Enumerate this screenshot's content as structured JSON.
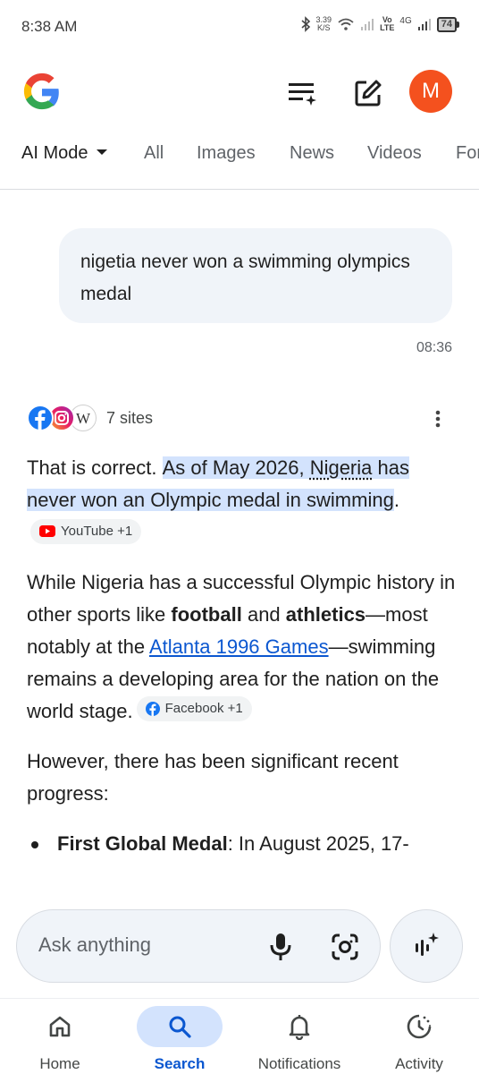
{
  "status_bar": {
    "time": "8:38 AM",
    "net_speed_value": "3.39",
    "net_speed_unit": "K/S",
    "network_label_top": "Vo",
    "network_label_bottom": "LTE",
    "network_type": "4G",
    "battery": "74"
  },
  "header": {
    "avatar_initial": "M",
    "avatar_color": "#f4511e"
  },
  "tabs": [
    {
      "label": "AI Mode",
      "active": true
    },
    {
      "label": "All"
    },
    {
      "label": "Images"
    },
    {
      "label": "News"
    },
    {
      "label": "Videos"
    },
    {
      "label": "For"
    }
  ],
  "query": {
    "text": "nigetia never won a swimming olympics medal",
    "time": "08:36"
  },
  "sources": {
    "label": "7 sites",
    "icons": [
      "facebook-icon",
      "instagram-icon",
      "wikipedia-icon"
    ]
  },
  "answer": {
    "p1_lead": "That is correct. ",
    "p1_hl_a": "As of May 2026, ",
    "p1_hl_b": "Nigeria",
    "p1_hl_c": " has never won an Olympic medal in swimming",
    "p1_end": ".",
    "p1_chip": "YouTube +1",
    "p2_a": "While Nigeria has a successful Olympic history in other sports like ",
    "p2_b": "football",
    "p2_c": " and ",
    "p2_d": "athletics",
    "p2_e": "—most notably at the ",
    "p2_link": "Atlanta 1996 Games",
    "p2_f": "—swimming remains a developing area for the nation on the world stage.",
    "p2_chip": "Facebook +1",
    "p3": "However, there has been significant recent progress:",
    "bullet_bold": "First Global Medal",
    "bullet_rest": ": In August 2025, 17-"
  },
  "ask_bar": {
    "placeholder": "Ask anything"
  },
  "bottom_nav": [
    {
      "label": "Home",
      "icon": "home-icon"
    },
    {
      "label": "Search",
      "icon": "search-icon",
      "active": true
    },
    {
      "label": "Notifications",
      "icon": "bell-icon"
    },
    {
      "label": "Activity",
      "icon": "activity-icon"
    }
  ],
  "colors": {
    "accent": "#0b57d0",
    "highlight": "#d3e3fd",
    "bubble": "#f0f4f9"
  }
}
